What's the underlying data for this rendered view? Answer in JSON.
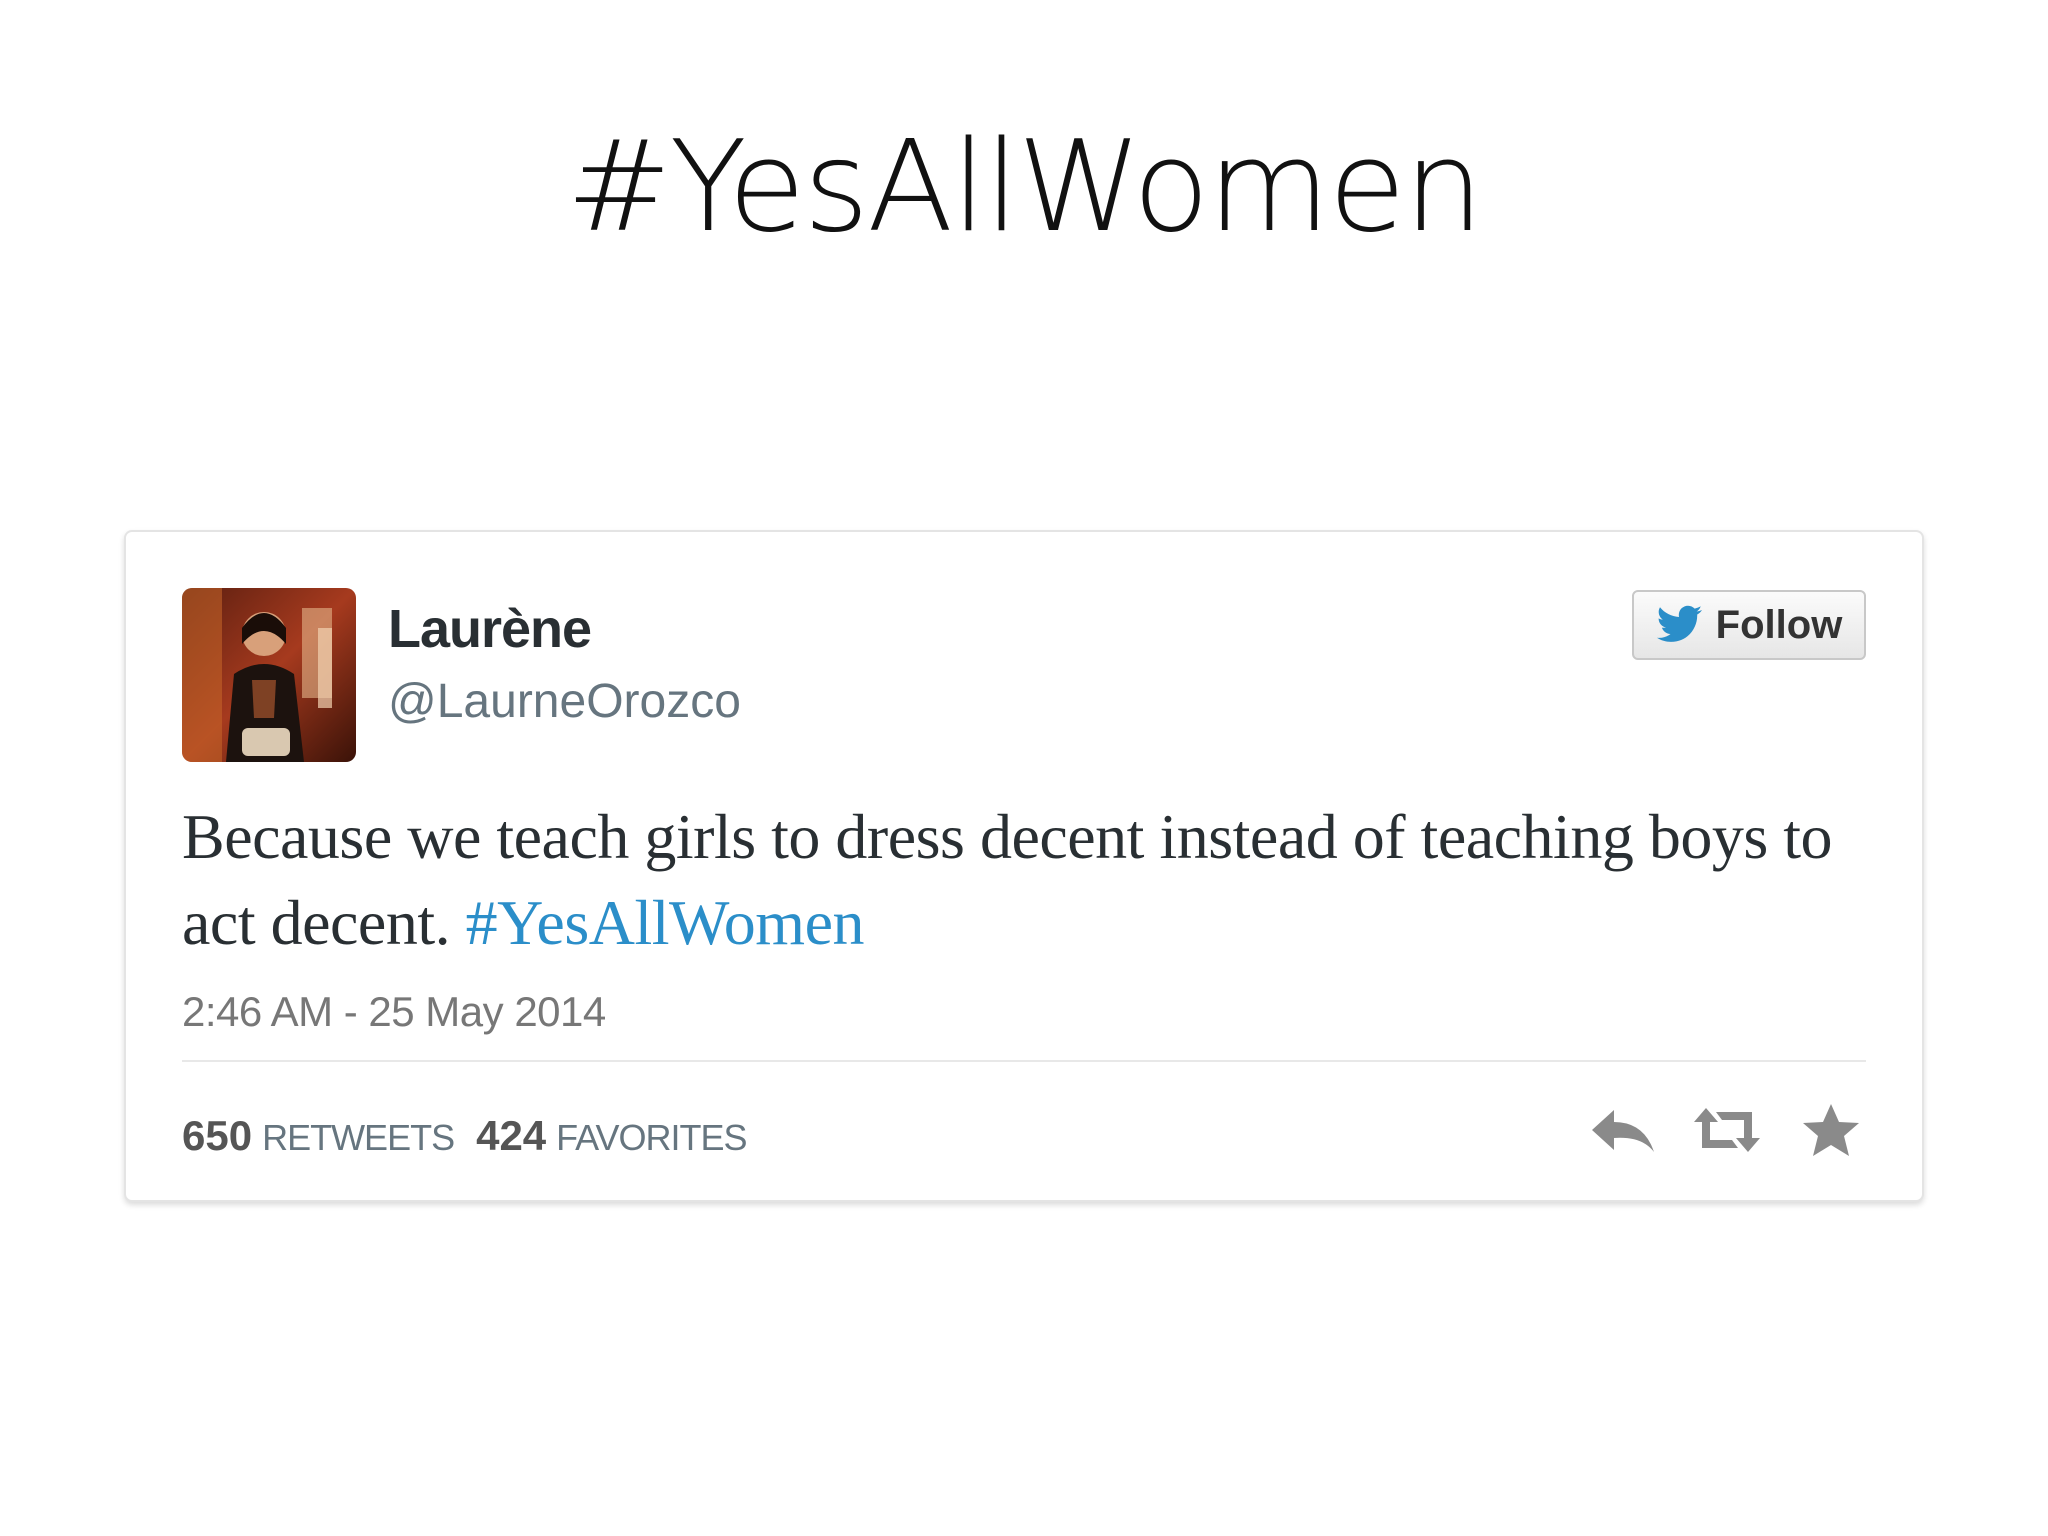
{
  "slide": {
    "title": "#YesAllWomen"
  },
  "tweet": {
    "display_name": "Laurène",
    "handle": "@LaurneOrozco",
    "follow_label": "Follow",
    "text_main": "Because we teach girls to dress decent instead of teaching boys to act decent. ",
    "hashtag": "#YesAllWomen",
    "timestamp": "2:46 AM - 25 May 2014",
    "retweet_count": "650",
    "retweet_label": "RETWEETS",
    "favorite_count": "424",
    "favorite_label": "FAVORITES",
    "actions": [
      "reply-icon",
      "retweet-icon",
      "favorite-icon"
    ]
  },
  "colors": {
    "hashtag": "#2b8ec9",
    "twitter_blue": "#2b8ec9",
    "icon_gray": "#8a8a8a"
  }
}
